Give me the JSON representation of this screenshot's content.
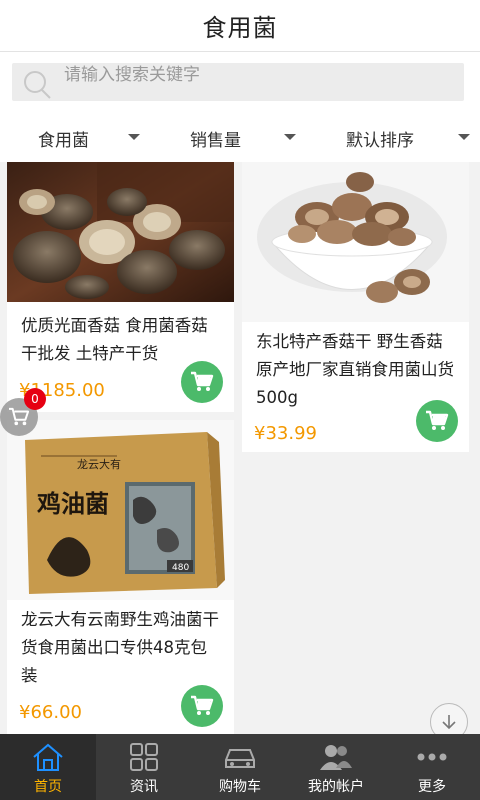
{
  "header": {
    "title": "食用菌"
  },
  "search": {
    "placeholder": "请输入搜索关键字"
  },
  "filters": [
    {
      "label": "食用菌"
    },
    {
      "label": "销售量"
    },
    {
      "label": "默认排序"
    }
  ],
  "products": [
    {
      "title": "优质光面香菇 食用菌香菇干批发 土特产干货",
      "price": "¥1185.00"
    },
    {
      "title": "东北特产香菇干 野生香菇 原产地厂家直销食用菌山货 500g",
      "price": "¥33.99"
    },
    {
      "title": "龙云大有云南野生鸡油菌干货食用菌出口专供48克包装",
      "price": "¥66.00"
    }
  ],
  "box_art": {
    "brand": "龙云大有",
    "name": "鸡油菌",
    "weight": "480"
  },
  "floating_cart": {
    "count": "0"
  },
  "tabbar": {
    "items": [
      {
        "label": "首页",
        "icon": "home-icon"
      },
      {
        "label": "资讯",
        "icon": "grid-icon"
      },
      {
        "label": "购物车",
        "icon": "car-icon"
      },
      {
        "label": "我的帐户",
        "icon": "users-icon"
      },
      {
        "label": "更多",
        "icon": "more-icon"
      }
    ],
    "active_color": "#ffb400"
  },
  "colors": {
    "accent_green": "#4cba6a",
    "price_orange": "#f39800",
    "badge_red": "#e60012"
  }
}
